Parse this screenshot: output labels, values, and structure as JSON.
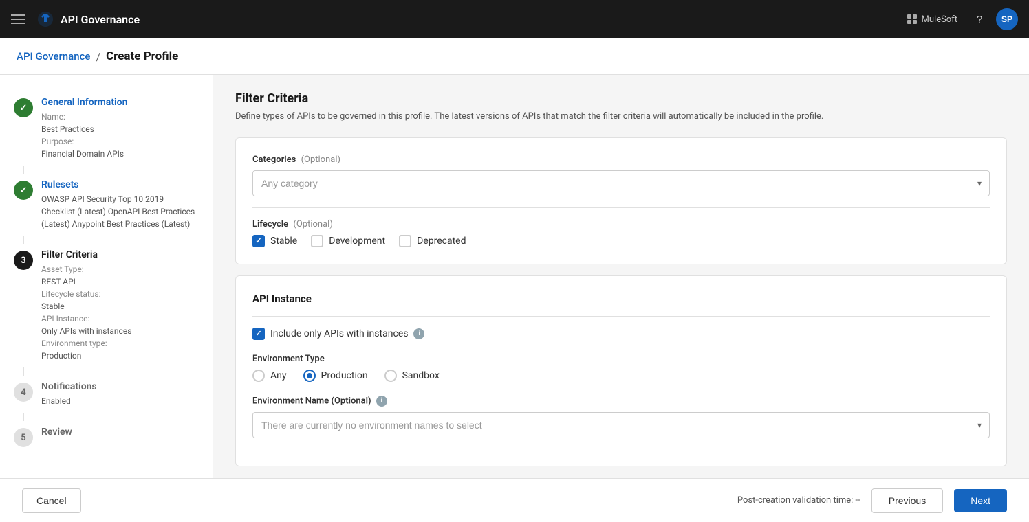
{
  "topnav": {
    "brand": "API Governance",
    "mulasoft": "MuleSoft",
    "help_label": "?",
    "avatar_label": "SP"
  },
  "breadcrumb": {
    "link_label": "API Governance",
    "separator": "/",
    "current": "Create Profile"
  },
  "sidebar": {
    "steps": [
      {
        "number": "1",
        "state": "done",
        "title": "General Information",
        "details": [
          {
            "label": "Name:",
            "value": "Best Practices"
          },
          {
            "label": "Purpose:",
            "value": "Financial Domain APIs"
          }
        ]
      },
      {
        "number": "2",
        "state": "done",
        "title": "Rulesets",
        "details": [
          {
            "label": "",
            "value": "OWASP API Security Top 10 2019"
          },
          {
            "label": "",
            "value": "Checklist (Latest) OpenAPI Best Practices"
          },
          {
            "label": "",
            "value": "(Latest) Anypoint Best Practices (Latest)"
          }
        ]
      },
      {
        "number": "3",
        "state": "active",
        "title": "Filter Criteria",
        "details": [
          {
            "label": "Asset Type:",
            "value": "REST API"
          },
          {
            "label": "Lifecycle status:",
            "value": "Stable"
          },
          {
            "label": "API Instance:",
            "value": "Only APIs with instances"
          },
          {
            "label": "Environment type:",
            "value": "Production"
          }
        ]
      },
      {
        "number": "4",
        "state": "pending",
        "title": "Notifications",
        "details": [
          {
            "label": "",
            "value": "Enabled"
          }
        ]
      },
      {
        "number": "5",
        "state": "pending",
        "title": "Review",
        "details": []
      }
    ]
  },
  "main": {
    "filter_criteria": {
      "title": "Filter Criteria",
      "description": "Define types of APIs to be governed in this profile. The latest versions of APIs that match the filter criteria will automatically be included in the profile.",
      "categories": {
        "label": "Categories",
        "optional_label": "(Optional)",
        "placeholder": "Any category"
      },
      "lifecycle": {
        "label": "Lifecycle",
        "optional_label": "(Optional)",
        "options": [
          {
            "id": "stable",
            "label": "Stable",
            "checked": true
          },
          {
            "id": "development",
            "label": "Development",
            "checked": false
          },
          {
            "id": "deprecated",
            "label": "Deprecated",
            "checked": false
          }
        ]
      }
    },
    "api_instance": {
      "title": "API Instance",
      "include_only_label": "Include only APIs with instances",
      "include_only_checked": true,
      "environment_type": {
        "label": "Environment Type",
        "options": [
          {
            "id": "any",
            "label": "Any",
            "selected": false
          },
          {
            "id": "production",
            "label": "Production",
            "selected": true
          },
          {
            "id": "sandbox",
            "label": "Sandbox",
            "selected": false
          }
        ]
      },
      "environment_name": {
        "label": "Environment Name",
        "optional_label": "(Optional)",
        "placeholder": "There are currently no environment names to select"
      }
    }
  },
  "footer": {
    "cancel_label": "Cancel",
    "validation_text": "Post-creation validation time: --",
    "previous_label": "Previous",
    "next_label": "Next"
  }
}
